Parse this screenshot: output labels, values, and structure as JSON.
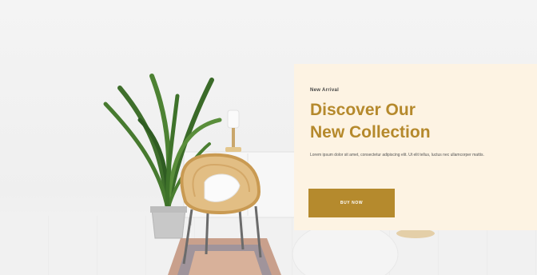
{
  "hero": {
    "eyebrow": "New Arrival",
    "headline_line1": "Discover Our",
    "headline_line2": "New Collection",
    "description": "Lorem ipsum dolor sit amet, consectetur adipiscing elit. Ut elit tellus, luctus nec ullamcorper mattis.",
    "button_label": "BUY NOW"
  },
  "colors": {
    "accent": "#b58a2d",
    "card_background": "#fdf3e3",
    "wall": "#f1f1f1"
  }
}
